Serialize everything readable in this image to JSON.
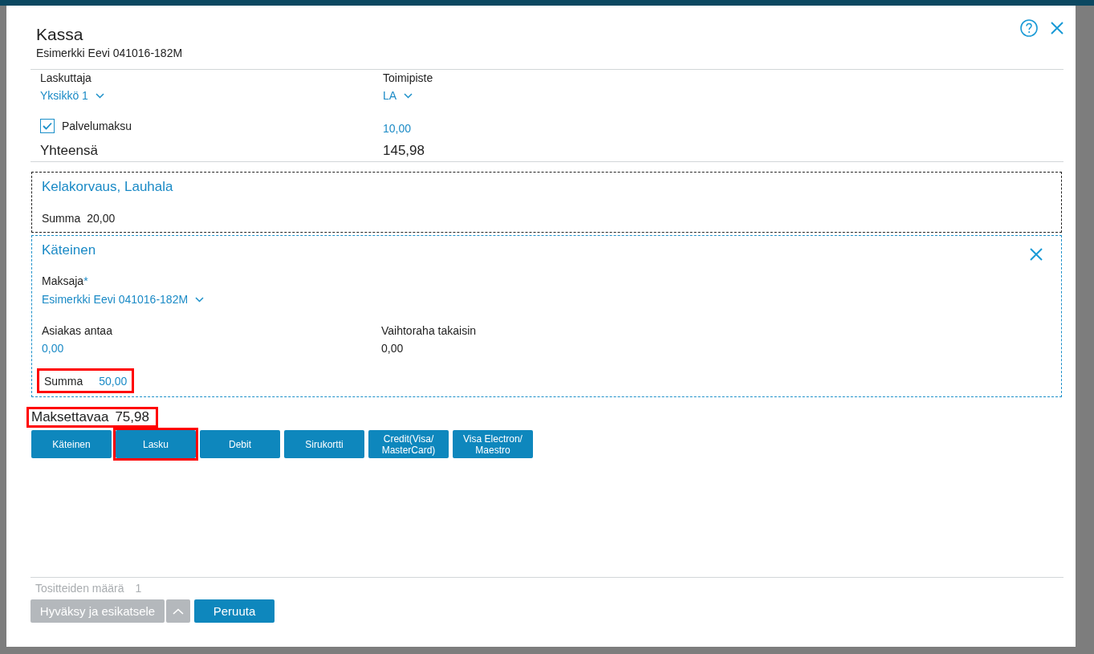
{
  "dialog": {
    "title": "Kassa",
    "subtitle": "Esimerkki Eevi 041016-182M"
  },
  "selectors": [
    {
      "kind": "dropdown",
      "label": "Laskuttaja",
      "value": "Yksikkö 1"
    },
    {
      "kind": "dropdown",
      "label": "Toimipiste",
      "value": "LA"
    }
  ],
  "service_fee": {
    "label": "Palvelumaksu",
    "checked": true,
    "amount": "10,00"
  },
  "total": {
    "label": "Yhteensä",
    "amount": "145,98"
  },
  "payments": [
    {
      "kind": "fixed",
      "title": "Kelakorvaus, Lauhala",
      "removable": false,
      "sum_label": "Summa",
      "sum": "20,00",
      "highlighted": false
    },
    {
      "kind": "cash",
      "title": "Käteinen",
      "removable": true,
      "payer": {
        "label": "Maksaja",
        "required_mark": "*",
        "value": "Esimerkki Eevi 041016-182M"
      },
      "given": {
        "label": "Asiakas antaa",
        "value": "0,00"
      },
      "change": {
        "label": "Vaihtoraha takaisin",
        "value": "0,00"
      },
      "sum_label": "Summa",
      "sum": "50,00",
      "highlighted": true
    }
  ],
  "amount_due": {
    "label": "Maksettavaa",
    "amount": "75,98",
    "highlighted": true
  },
  "payment_methods": [
    {
      "label": "Käteinen",
      "highlighted": false
    },
    {
      "label": "Lasku",
      "highlighted": true
    },
    {
      "label": "Debit",
      "highlighted": false
    },
    {
      "label": "Sirukortti",
      "highlighted": false
    },
    {
      "label": "Credit(Visa/\nMasterCard)",
      "highlighted": false
    },
    {
      "label": "Visa Electron/\nMaestro",
      "highlighted": false
    }
  ],
  "footer": {
    "count_label": "Tositteiden määrä",
    "count": "1",
    "actions": [
      {
        "kind": "split",
        "label": "Hyväksy ja esikatsele",
        "disabled": true
      },
      {
        "kind": "plain",
        "label": "Peruuta",
        "disabled": false
      }
    ]
  }
}
